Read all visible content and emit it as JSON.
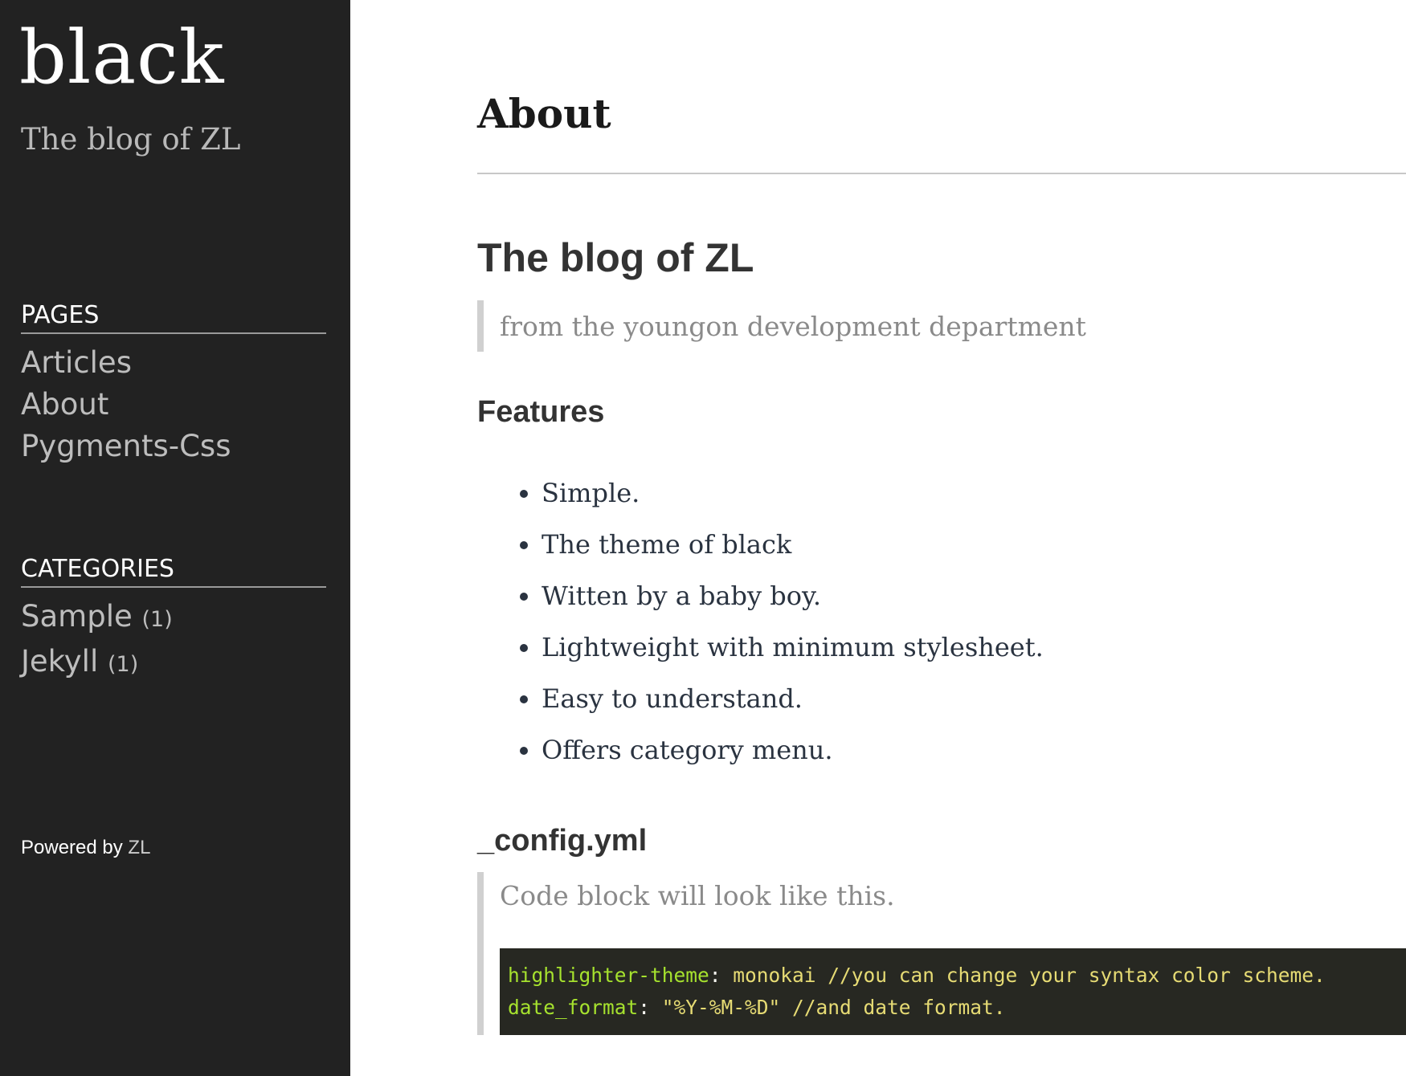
{
  "sidebar": {
    "title": "black",
    "subtitle": "The blog of ZL",
    "pages": {
      "heading": "PAGES",
      "items": [
        {
          "label": "Articles"
        },
        {
          "label": "About"
        },
        {
          "label": "Pygments-Css"
        }
      ]
    },
    "categories": {
      "heading": "CATEGORIES",
      "items": [
        {
          "label": "Sample",
          "count": "(1)"
        },
        {
          "label": "Jekyll",
          "count": "(1)"
        }
      ]
    },
    "footer": {
      "prefix": "Powered by",
      "link": "ZL"
    }
  },
  "main": {
    "page_title": "About",
    "blog_heading": "The blog of ZL",
    "tagline": "from the youngon development department",
    "features_heading": "Features",
    "features": [
      "Simple.",
      "The theme of black",
      "Witten by a baby boy.",
      "Lightweight with minimum stylesheet.",
      "Easy to understand.",
      "Offers category menu."
    ],
    "config_heading": "_config.yml",
    "config_quote": "Code block will look like this.",
    "code": {
      "line1": {
        "key": "highlighter-theme",
        "sep": ":",
        "value": " monokai //you can change your syntax color scheme."
      },
      "line2": {
        "key": "date_format",
        "sep": ":",
        "value": " \"%Y-%M-%D\" //and date format."
      }
    }
  },
  "colors": {
    "sidebar_bg": "#222222",
    "code_bg": "#272822",
    "code_key": "#a6e22e",
    "code_string": "#e6db74"
  }
}
